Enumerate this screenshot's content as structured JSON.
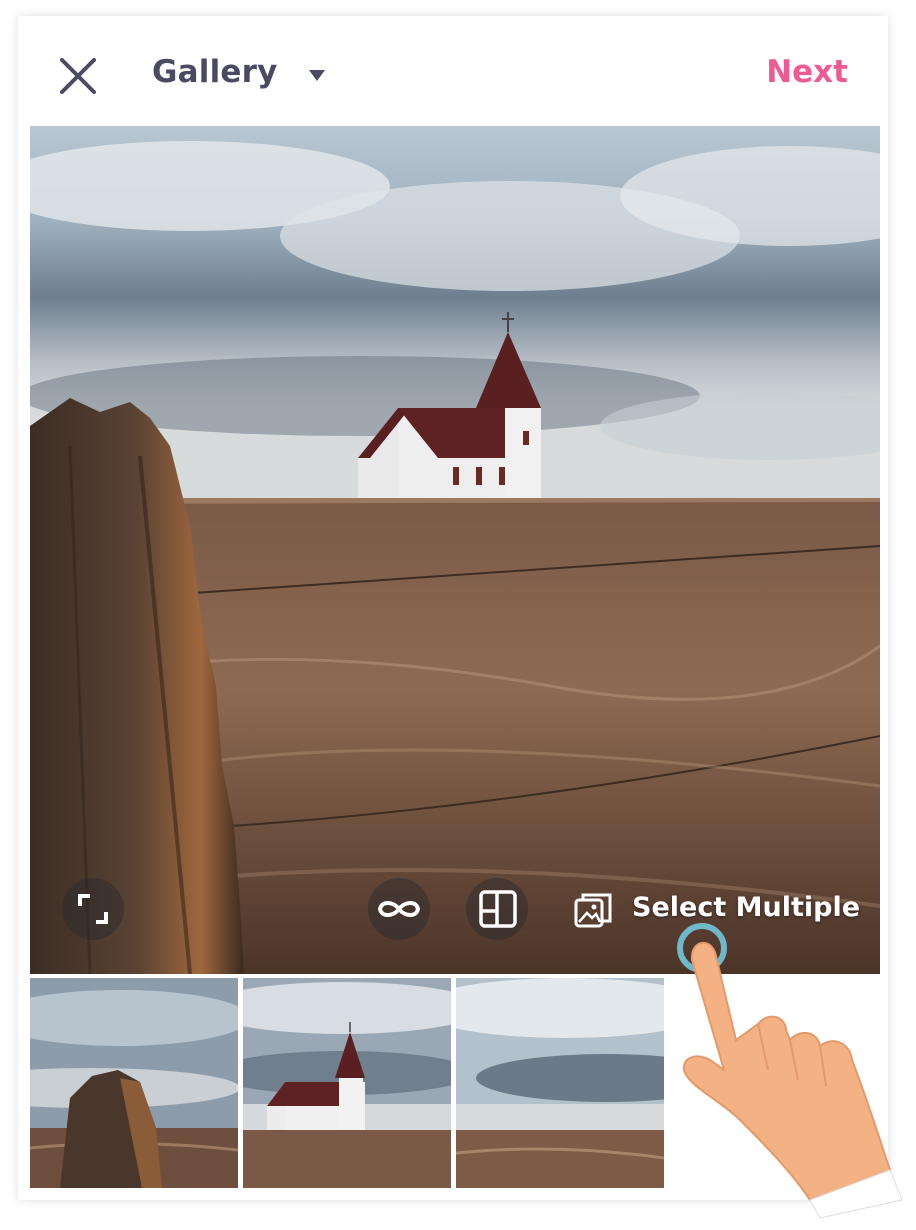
{
  "header": {
    "close_icon": "close-icon",
    "title": "Gallery",
    "dropdown_icon": "caret-down-icon",
    "next_label": "Next"
  },
  "preview": {
    "image": "church-field-photo",
    "tools": {
      "expand_icon": "expand-icon",
      "infinity_icon": "infinity-icon",
      "layout_icon": "layout-icon",
      "select_multiple_icon": "photos-icon",
      "select_multiple_label": "Select Multiple"
    }
  },
  "thumbnails": [
    {
      "image": "fence-post-photo"
    },
    {
      "image": "church-photo"
    },
    {
      "image": "field-photo"
    }
  ],
  "colors": {
    "accent": "#ee5a93",
    "title": "#4a4a62",
    "tap_ring": "#6fb8c9"
  }
}
